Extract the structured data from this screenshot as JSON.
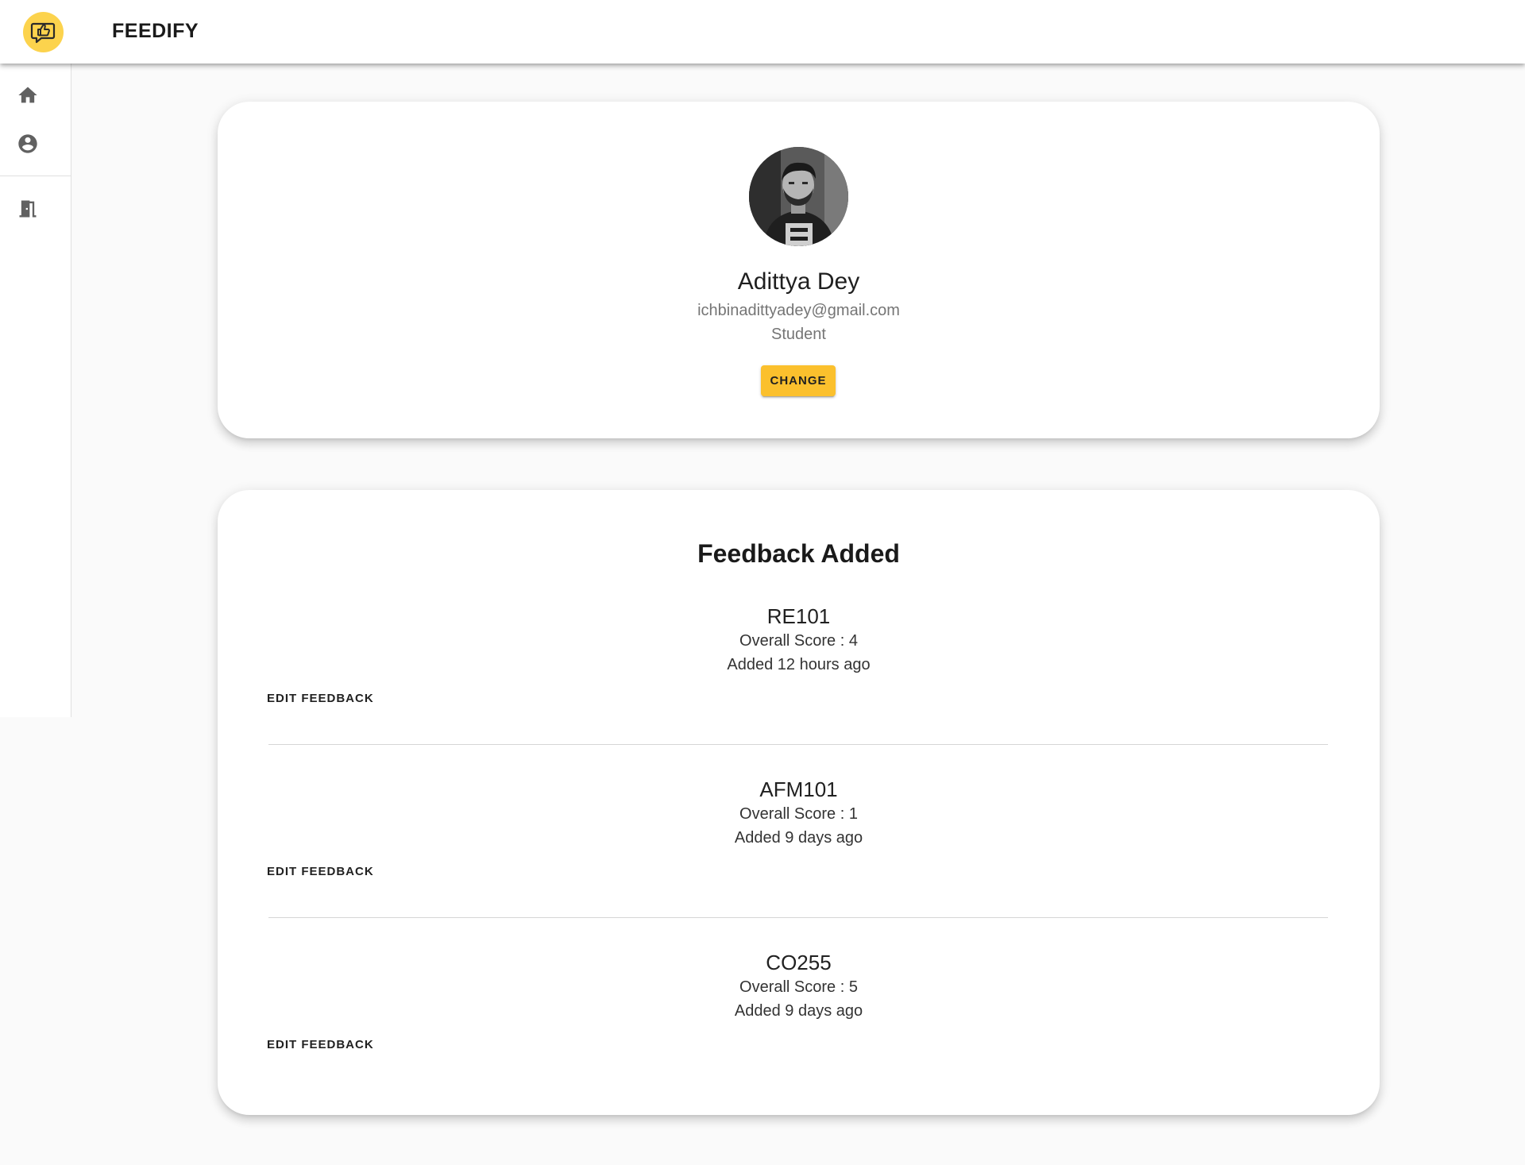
{
  "app": {
    "title": "FEEDIFY",
    "accent_color": "#fbc02d",
    "logo_icon": "thumbs-up-chat-icon"
  },
  "sidebar": {
    "items": [
      {
        "name": "home",
        "icon": "home-icon"
      },
      {
        "name": "profile",
        "icon": "account-circle-icon"
      },
      {
        "name": "logout",
        "icon": "door-exit-icon"
      }
    ]
  },
  "profile": {
    "name": "Adittya Dey",
    "email": "ichbinadittyadey@gmail.com",
    "role": "Student",
    "change_label": "CHANGE"
  },
  "feedback": {
    "heading": "Feedback Added",
    "items": [
      {
        "course": "RE101",
        "score_text": "Overall Score : 4",
        "added": "Added 12 hours ago",
        "edit_label": "EDIT FEEDBACK"
      },
      {
        "course": "AFM101",
        "score_text": "Overall Score : 1",
        "added": "Added 9 days ago",
        "edit_label": "EDIT FEEDBACK"
      },
      {
        "course": "CO255",
        "score_text": "Overall Score : 5",
        "added": "Added 9 days ago",
        "edit_label": "EDIT FEEDBACK"
      }
    ]
  }
}
